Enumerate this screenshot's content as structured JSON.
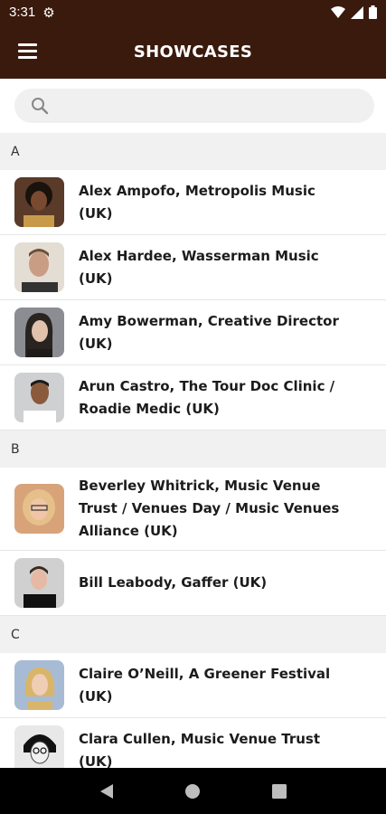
{
  "status": {
    "time": "3:31"
  },
  "header": {
    "title": "SHOWCASES"
  },
  "search": {
    "placeholder": ""
  },
  "sections": [
    {
      "letter": "A",
      "items": [
        {
          "name": "Alex Ampofo, Metropolis Music (UK)",
          "avatar": "#5a3a28"
        },
        {
          "name": "Alex Hardee, Wasserman Music (UK)",
          "avatar": "#b59c86"
        },
        {
          "name": "Amy Bowerman, Creative Director (UK)",
          "avatar": "#8b8d92"
        },
        {
          "name": "Arun Castro, The Tour Doc  Clinic / Roadie Medic (UK)",
          "avatar": "#cfd0d2"
        }
      ]
    },
    {
      "letter": "B",
      "items": [
        {
          "name": "Beverley Whitrick,  Music Venue Trust / Venues Day / Music Venues Alliance (UK)",
          "avatar": "#d9a37a"
        },
        {
          "name": "Bill Leabody, Gaffer (UK)",
          "avatar": "#d0d0d0"
        }
      ]
    },
    {
      "letter": "C",
      "items": [
        {
          "name": "Claire O’Neill, A Greener Festival (UK)",
          "avatar": "#a7bcd4"
        },
        {
          "name": "Clara Cullen,  Music Venue Trust  (UK)",
          "avatar": "#e8e8e8"
        }
      ]
    }
  ]
}
